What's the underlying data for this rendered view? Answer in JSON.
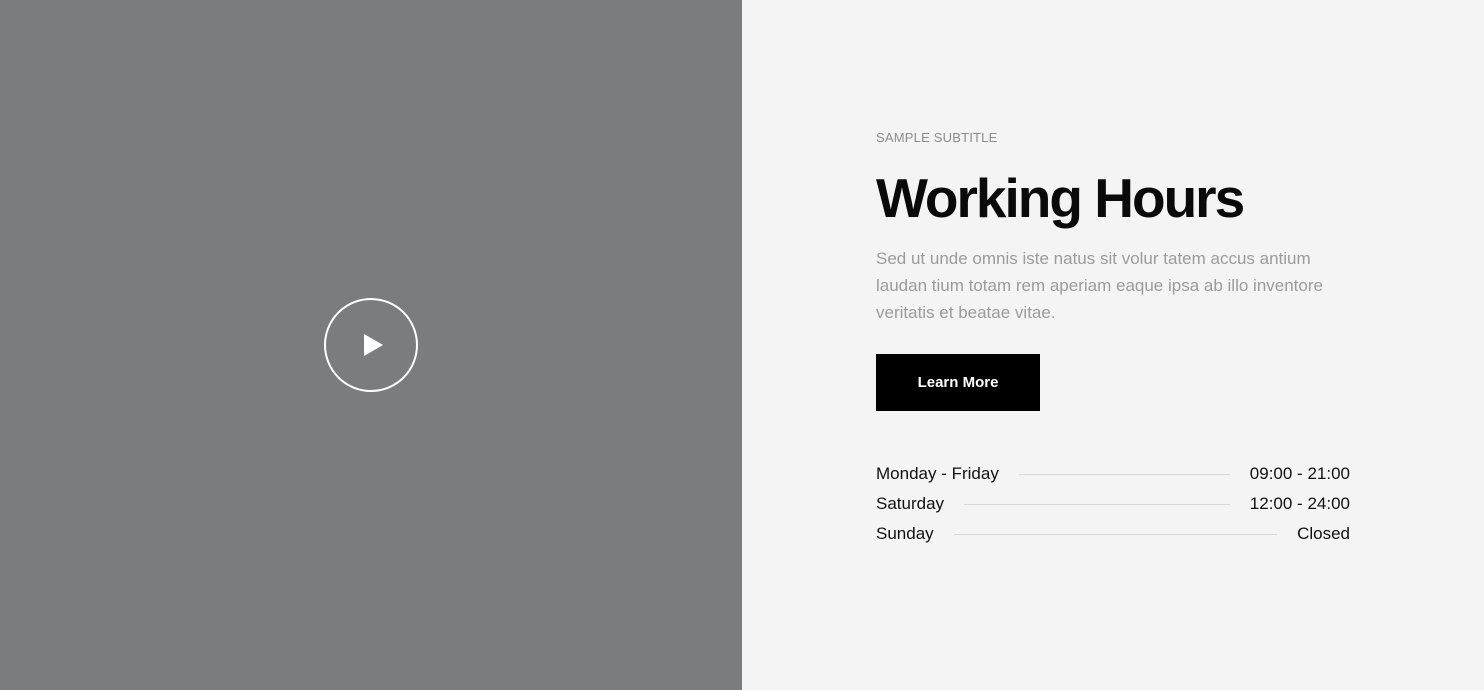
{
  "hero": {
    "subtitle": "SAMPLE SUBTITLE",
    "title": "Working Hours",
    "description": "Sed ut unde omnis iste natus sit volur tatem accus antium laudan tium totam rem aperiam eaque ipsa ab illo inventore veritatis et beatae vitae.",
    "cta_label": "Learn More"
  },
  "video": {
    "play_icon": "play-icon"
  },
  "hours": [
    {
      "day": "Monday - Friday",
      "time": "09:00 - 21:00"
    },
    {
      "day": "Saturday",
      "time": "12:00 - 24:00"
    },
    {
      "day": "Sunday",
      "time": "Closed"
    }
  ],
  "colors": {
    "video_background": "#7b7c7e",
    "content_background": "#f4f4f4",
    "button_background": "#000000",
    "title": "#0a0a0a",
    "muted_text": "#9b9b9b"
  }
}
